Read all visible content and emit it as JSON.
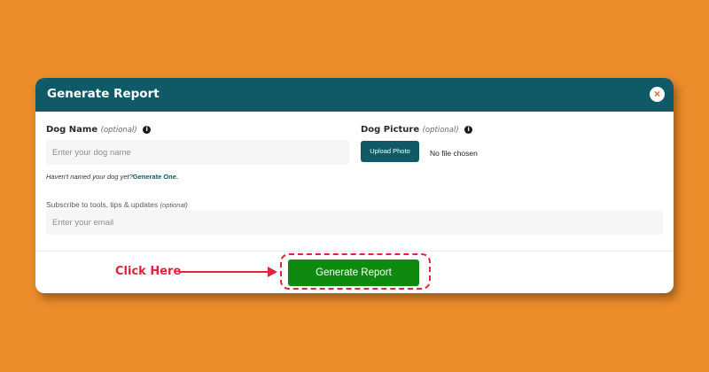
{
  "modal": {
    "title": "Generate Report",
    "close_glyph": "×"
  },
  "dog_name": {
    "label": "Dog Name",
    "optional": "(optional)",
    "placeholder": "Enter your dog name",
    "helper": "Haven't named your dog yet?",
    "helper_link": "Generate One."
  },
  "dog_picture": {
    "label": "Dog Picture",
    "optional": "(optional)",
    "upload_label": "Upload Photo",
    "file_status": "No file chosen"
  },
  "subscribe": {
    "label": "Subscribe to tools, tips & updates",
    "optional": "(optional)",
    "placeholder": "Enter your email"
  },
  "actions": {
    "generate_label": "Generate Report"
  },
  "annotation": {
    "text": "Click Here",
    "color": "#e2233b"
  },
  "colors": {
    "background": "#ec8c2a",
    "header": "#0f5a66",
    "primary_button": "#0e8a0e"
  },
  "icons": {
    "info": "info-icon",
    "close": "close-icon",
    "arrow": "arrow-right-icon"
  }
}
